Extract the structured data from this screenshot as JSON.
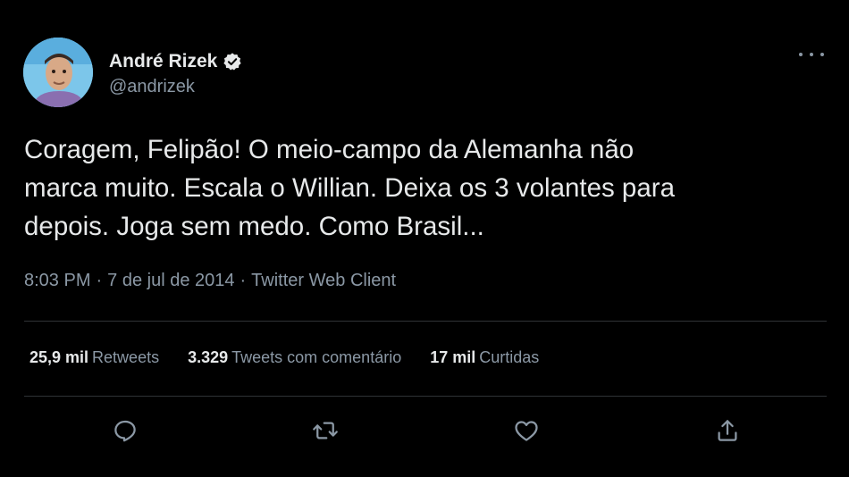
{
  "user": {
    "display_name": "André Rizek",
    "handle": "@andrizek",
    "verified_icon": "verified-badge-icon"
  },
  "tweet": {
    "text": "Coragem, Felipão! O meio-campo da Alemanha não\nmarca muito. Escala o Willian. Deixa os 3 volantes para\ndepois. Joga sem medo. Como Brasil...",
    "time": "8:03 PM",
    "date": "7 de jul de 2014",
    "client": "Twitter Web Client",
    "separator": "·"
  },
  "stats": {
    "retweets_count": "25,9 mil",
    "retweets_label": "Retweets",
    "quotes_count": "3.329",
    "quotes_label": "Tweets com comentário",
    "likes_count": "17 mil",
    "likes_label": "Curtidas"
  },
  "actions": [
    {
      "icon": "reply-icon"
    },
    {
      "icon": "retweet-icon"
    },
    {
      "icon": "like-icon"
    },
    {
      "icon": "share-icon"
    }
  ],
  "colors": {
    "background": "#000000",
    "text_primary": "#e7e9ea",
    "text_secondary": "#8b98a5",
    "divider": "#2f3336"
  }
}
